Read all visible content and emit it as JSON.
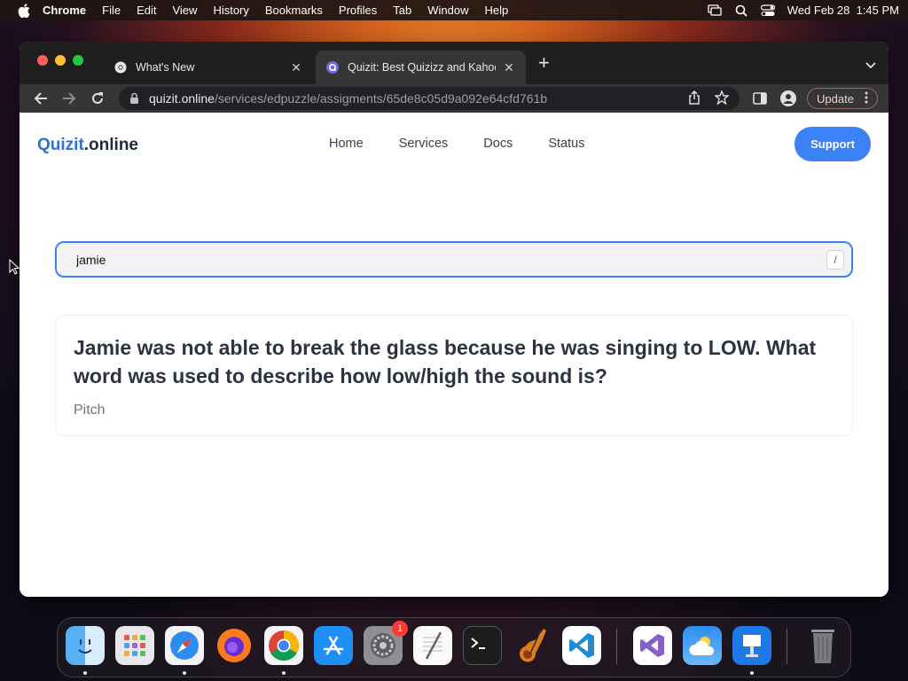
{
  "menubar": {
    "app_name": "Chrome",
    "items": [
      "File",
      "Edit",
      "View",
      "History",
      "Bookmarks",
      "Profiles",
      "Tab",
      "Window",
      "Help"
    ],
    "datetime": "Wed Feb 28  1:45 PM"
  },
  "browser": {
    "tabs": [
      {
        "title": "What's New",
        "favicon": "chrome-icon"
      },
      {
        "title": "Quizit: Best Quizizz and Kahoot",
        "favicon": "quizit-icon"
      }
    ],
    "url_host": "quizit.online",
    "url_path": "/services/edpuzzle/assigments/65de8c05d9a092e64cfd761b",
    "update_label": "Update"
  },
  "site": {
    "logo_brand": "Quizit",
    "logo_suffix": ".online",
    "nav": [
      "Home",
      "Services",
      "Docs",
      "Status"
    ],
    "support_label": "Support"
  },
  "search": {
    "value": "jamie",
    "shortcut": "/"
  },
  "result": {
    "question": "Jamie was not able to break the glass because he was singing to LOW. What word was used to describe how low/high the sound is?",
    "answer": "Pitch"
  },
  "dock": {
    "apps": [
      "finder",
      "launchpad",
      "safari",
      "firefox",
      "chrome",
      "app-store",
      "system-settings",
      "textedit",
      "terminal",
      "garageband",
      "vscode",
      "visual-studio",
      "weather",
      "keynote",
      "trash"
    ],
    "settings_badge": "1"
  }
}
